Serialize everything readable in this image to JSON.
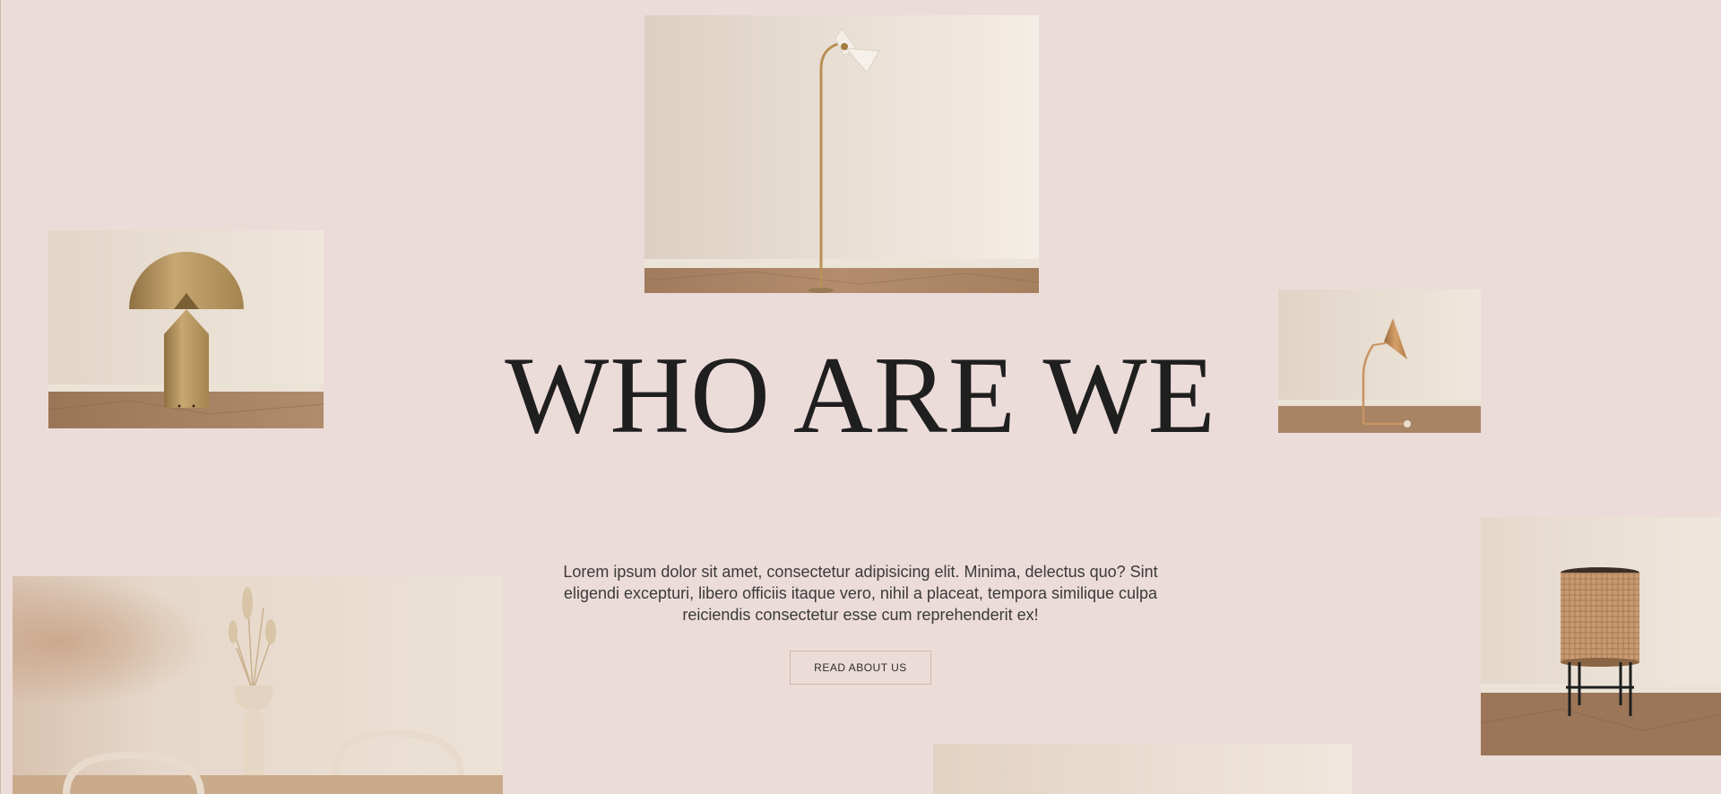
{
  "hero": {
    "headline": "WHO ARE WE",
    "intro": "Lorem ipsum dolor sit amet, consectetur adipisicing elit. Minima, delectus quo? Sint eligendi excepturi, libero officiis itaque vero, nihil a placeat, tempora similique culpa reiciendis consectetur esse cum reprehenderit ex!",
    "cta_label": "READ ABOUT US"
  },
  "gallery": [
    {
      "name": "floor-lamp-photo",
      "subject": "brass floor lamp with white shade"
    },
    {
      "name": "dome-lamp-photo",
      "subject": "brass dome table lamp"
    },
    {
      "name": "wall-lamp-photo",
      "subject": "copper desk lamp"
    },
    {
      "name": "rattan-lamp-photo",
      "subject": "rattan lamp on black stand"
    },
    {
      "name": "dining-photo",
      "subject": "vase with dried grass and chairs"
    },
    {
      "name": "interior-photo",
      "subject": "beige interior"
    }
  ],
  "colors": {
    "background": "#ecdcd9",
    "text": "#1f1f1f",
    "button_border": "#d2b6aa"
  }
}
